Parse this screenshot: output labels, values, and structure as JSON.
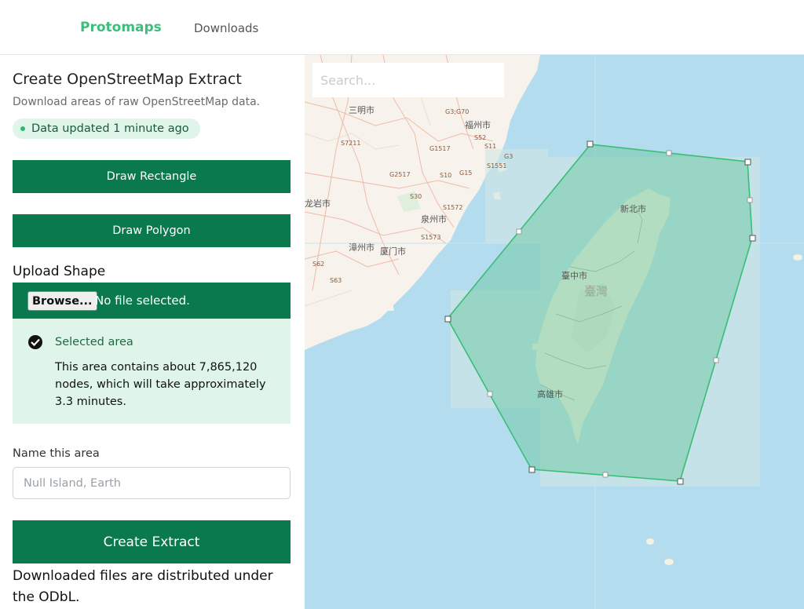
{
  "nav": {
    "brand": "Protomaps",
    "downloads": "Downloads"
  },
  "sidebar": {
    "title": "Create OpenStreetMap Extract",
    "subtitle": "Download areas of raw OpenStreetMap data.",
    "status_badge": "Data updated 1 minute ago",
    "draw_rectangle": "Draw Rectangle",
    "draw_polygon": "Draw Polygon",
    "upload_label": "Upload Shape",
    "browse_button": "Browse...",
    "file_status": "No file selected.",
    "selected_area": {
      "title": "Selected area",
      "text": "This area contains about 7,865,120 nodes, which will take approximately 3.3 minutes."
    },
    "name_label": "Name this area",
    "name_placeholder": "Null Island, Earth",
    "create_button": "Create Extract",
    "footer": "Downloaded files are distributed under the ODbL."
  },
  "map": {
    "search_placeholder": "Search...",
    "colors": {
      "sea": "#b4dcef",
      "land": "#f7f3ec",
      "polygon_fill": "#63c59a",
      "polygon_stroke": "#3bbd75",
      "brand": "#3cbf7a",
      "button": "#0a7a4e"
    },
    "place_labels": [
      "三明市",
      "福州市",
      "龙岩市",
      "泉州市",
      "漳州市",
      "厦门市",
      "新北市",
      "臺中市",
      "臺灣",
      "高雄市"
    ],
    "road_labels": [
      "G3;G70",
      "S52",
      "S11",
      "G3",
      "S7211",
      "G1517",
      "S1551",
      "G2517",
      "S10",
      "G15",
      "S30",
      "S1572",
      "S1573",
      "S62",
      "S63"
    ]
  }
}
